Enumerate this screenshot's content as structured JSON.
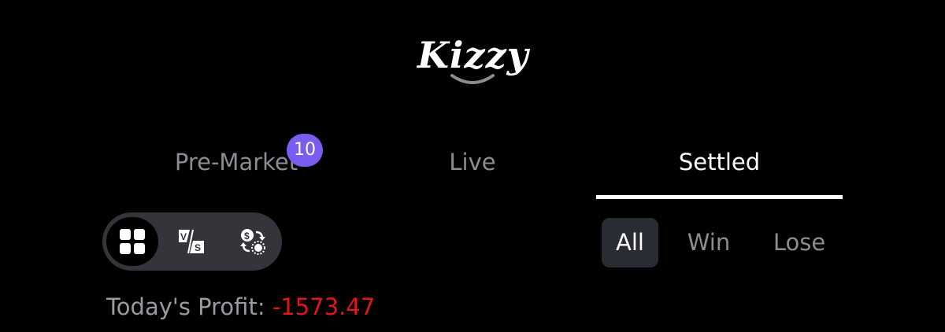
{
  "logo": {
    "text": "Kizzy"
  },
  "tabs": [
    {
      "label": "Pre-Market",
      "badge": "10",
      "active": false
    },
    {
      "label": "Live",
      "active": false
    },
    {
      "label": "Settled",
      "active": true
    }
  ],
  "view_toggle": [
    {
      "icon": "grid-icon",
      "active": true
    },
    {
      "icon": "vs-icon",
      "active": false
    },
    {
      "icon": "dollar-exchange-icon",
      "active": false
    }
  ],
  "filters": [
    {
      "label": "All",
      "active": true
    },
    {
      "label": "Win",
      "active": false
    },
    {
      "label": "Lose",
      "active": false
    }
  ],
  "profit": {
    "label": "Today's Profit:",
    "value": "-1573.47"
  },
  "colors": {
    "background": "#000000",
    "badge": "#7b5cf0",
    "profit_negative": "#e0161c",
    "inactive_text": "#8c8c92",
    "toggle_bg": "#34353a",
    "filter_active_bg": "#2a2c33"
  }
}
